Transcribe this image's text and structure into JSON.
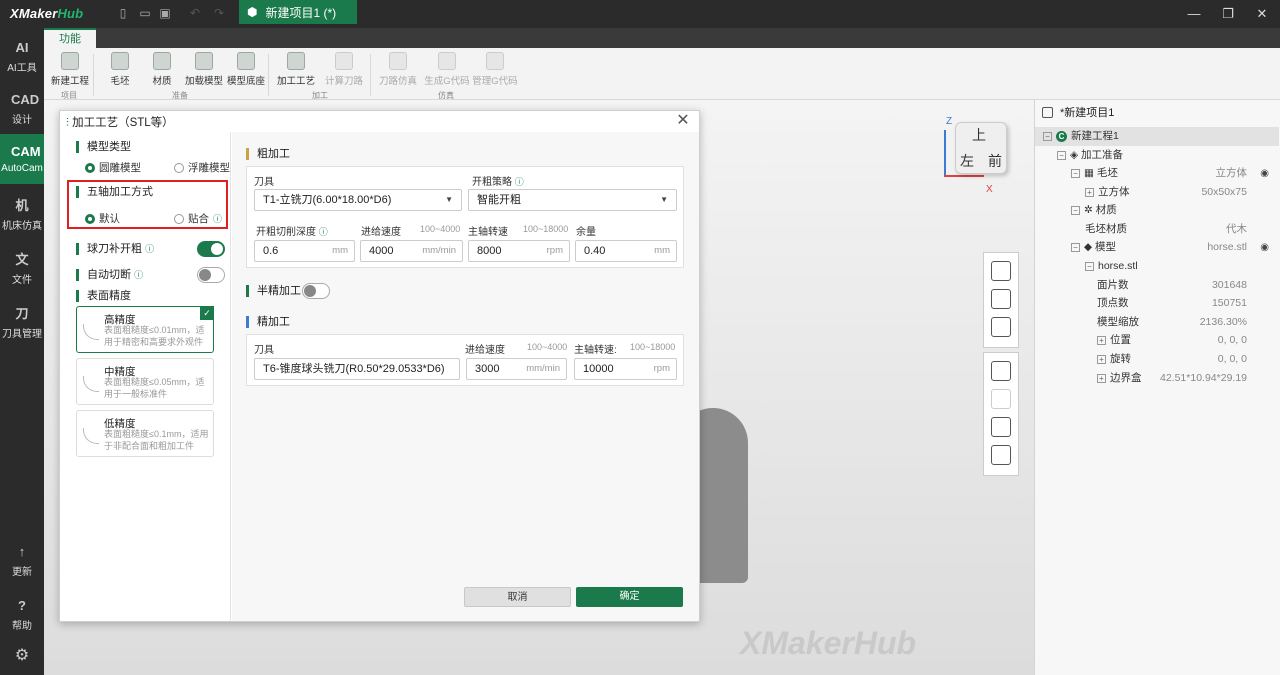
{
  "app": {
    "logo_a": "XMaker",
    "logo_b": "Hub",
    "project_tab": "新建项目1 (*)"
  },
  "sidebar": {
    "items": [
      {
        "icon": "AI",
        "label": "AI工具"
      },
      {
        "icon": "CAD",
        "label": "设计"
      },
      {
        "icon": "CAM",
        "label": "AutoCam"
      },
      {
        "icon": "机",
        "label": "机床仿真"
      },
      {
        "icon": "文",
        "label": "文件"
      },
      {
        "icon": "刀",
        "label": "刀具管理"
      },
      {
        "icon": "↑",
        "label": "更新"
      },
      {
        "icon": "?",
        "label": "帮助"
      },
      {
        "icon": "⚙",
        "label": ""
      }
    ]
  },
  "ribbon": {
    "tab": "功能",
    "buttons": [
      "新建工程",
      "毛坯",
      "材质",
      "加载模型",
      "模型底座",
      "加工工艺",
      "计算刀路",
      "刀路仿真",
      "生成G代码",
      "管理G代码"
    ],
    "groups": [
      "项目",
      "准备",
      "加工",
      "仿真"
    ]
  },
  "viewport": {
    "watermark": "XMakerHub",
    "cube": {
      "top": "上",
      "left": "左",
      "front": "前",
      "z": "Z",
      "x": "X"
    }
  },
  "tree": {
    "title": "*新建项目1",
    "rows": [
      {
        "label": "新建工程1",
        "value": ""
      },
      {
        "label": "加工准备",
        "value": ""
      },
      {
        "label": "毛坯",
        "value": "立方体"
      },
      {
        "label": "立方体",
        "value": "50x50x75"
      },
      {
        "label": "材质",
        "value": ""
      },
      {
        "label": "毛坯材质",
        "value": "代木"
      },
      {
        "label": "模型",
        "value": "horse.stl"
      },
      {
        "label": "horse.stl",
        "value": ""
      },
      {
        "label": "面片数",
        "value": "301648"
      },
      {
        "label": "顶点数",
        "value": "150751"
      },
      {
        "label": "模型缩放",
        "value": "2136.30%"
      },
      {
        "label": "位置",
        "value": "0, 0, 0"
      },
      {
        "label": "旋转",
        "value": "0, 0, 0"
      },
      {
        "label": "边界盒",
        "value": "42.51*10.94*29.19"
      }
    ]
  },
  "dialog": {
    "title": "加工工艺（STL等）",
    "model_type": {
      "label": "模型类型",
      "opt1": "圆雕模型",
      "opt2": "浮雕模型",
      "selected": "圆雕模型"
    },
    "five_axis": {
      "label": "五轴加工方式",
      "opt1": "默认",
      "opt2": "贴合",
      "selected": "默认"
    },
    "ball_rough": {
      "label": "球刀补开粗",
      "on": true
    },
    "auto_cut": {
      "label": "自动切断",
      "on": false
    },
    "precision": {
      "label": "表面精度",
      "cards": [
        {
          "title": "高精度",
          "desc": "表面粗糙度≤0.01mm，适用于精密和高要求外观件",
          "selected": true
        },
        {
          "title": "中精度",
          "desc": "表面粗糙度≤0.05mm，适用于一般标准件",
          "selected": false
        },
        {
          "title": "低精度",
          "desc": "表面粗糙度≤0.1mm，适用于非配合面和粗加工件",
          "selected": false
        }
      ]
    },
    "rough": {
      "label": "粗加工",
      "tool_label": "刀具",
      "tool_value": "T1-立铣刀(6.00*18.00*D6)",
      "strategy_label": "开粗策略",
      "strategy_value": "智能开粗",
      "depth_label": "开粗切削深度",
      "depth_value": "0.6",
      "depth_unit": "mm",
      "feed_label": "进给速度",
      "feed_range": "100~4000",
      "feed_value": "4000",
      "feed_unit": "mm/min",
      "spindle_label": "主轴转速",
      "spindle_range": "100~18000",
      "spindle_value": "8000",
      "spindle_unit": "rpm",
      "allow_label": "余量",
      "allow_value": "0.40",
      "allow_unit": "mm"
    },
    "semi": {
      "label": "半精加工",
      "on": false
    },
    "finish": {
      "label": "精加工",
      "tool_label": "刀具",
      "tool_value": "T6-锥度球头铣刀(R0.50*29.0533*D6)",
      "feed_label": "进给速度",
      "feed_range": "100~4000",
      "feed_value": "3000",
      "feed_unit": "mm/min",
      "spindle_label": "主轴转速:",
      "spindle_range": "100~18000",
      "spindle_value": "10000",
      "spindle_unit": "rpm"
    },
    "cancel": "取消",
    "ok": "确定"
  },
  "colors": {
    "accent": "#1b7a4b",
    "highlight": "#e02020"
  }
}
